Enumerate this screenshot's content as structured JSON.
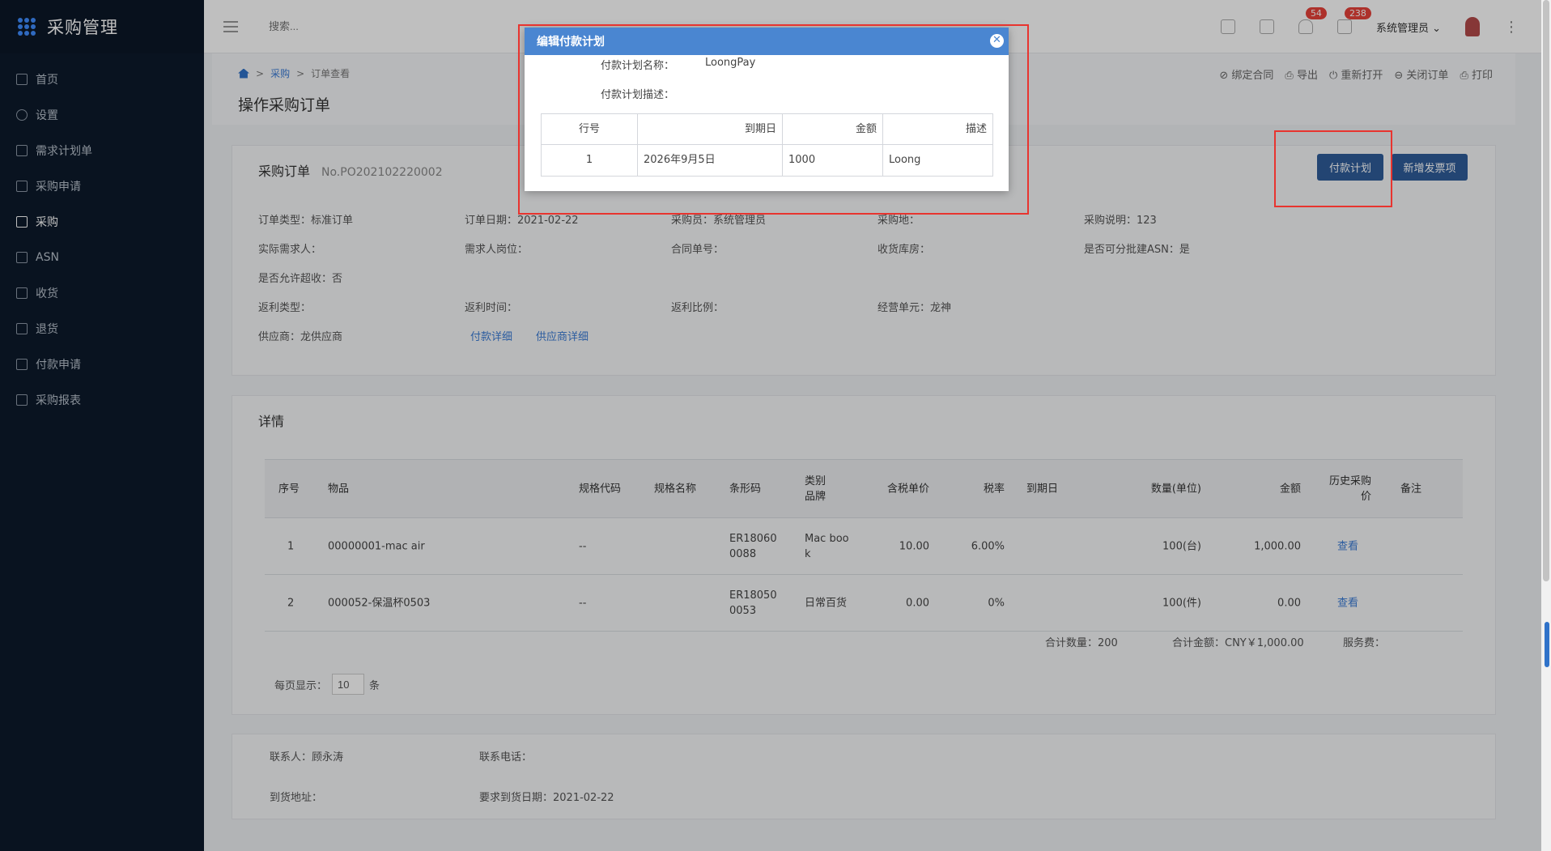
{
  "app": {
    "title": "采购管理"
  },
  "sidebar": {
    "items": [
      {
        "label": "首页",
        "icon": "home-icon"
      },
      {
        "label": "设置",
        "icon": "gear-icon"
      },
      {
        "label": "需求计划单",
        "icon": "document-icon"
      },
      {
        "label": "采购申请",
        "icon": "document-icon"
      },
      {
        "label": "采购",
        "icon": "document-icon",
        "active": true
      },
      {
        "label": "ASN",
        "icon": "truck-icon"
      },
      {
        "label": "收货",
        "icon": "inbox-icon"
      },
      {
        "label": "退货",
        "icon": "exit-icon"
      },
      {
        "label": "付款申请",
        "icon": "document-icon"
      },
      {
        "label": "采购报表",
        "icon": "chart-icon"
      }
    ]
  },
  "topbar": {
    "search_placeholder": "搜索...",
    "notifications_count": "54",
    "messages_count": "238",
    "user_name": "系统管理员"
  },
  "page": {
    "breadcrumb": [
      "采购",
      "订单查看"
    ],
    "title": "操作采购订单",
    "actions": [
      "绑定合同",
      "导出",
      "重新打开",
      "关闭订单",
      "打印"
    ]
  },
  "order": {
    "title": "采购订单",
    "number": "No.PO202102220002",
    "pay_plan_button": "付款计划",
    "new_invoice_button": "新增发票项",
    "fields": {
      "order_type": "订单类型：标准订单",
      "order_date": "订单日期：2021-02-22",
      "buyer": "采购员：系统管理员",
      "purchase_place": "采购地：",
      "purchase_desc": "采购说明：123",
      "actual_requester": "实际需求人：",
      "requester_post": "需求人岗位：",
      "contract_no": "合同单号：",
      "warehouse": "收货库房：",
      "batch_asn": "是否可分批建ASN：是",
      "over_receive": "是否允许超收：否",
      "rebate_type": "返利类型：",
      "rebate_time": "返利时间：",
      "rebate_ratio": "返利比例：",
      "business_unit": "经营单元：龙神",
      "supplier": "供应商：龙供应商"
    },
    "payment_detail_link": "付款详细",
    "supplier_detail_link": "供应商详细"
  },
  "details": {
    "title": "详情",
    "columns": [
      "序号",
      "物品",
      "规格代码",
      "规格名称",
      "条形码",
      "类别",
      "品牌",
      "含税单价",
      "税率",
      "到期日",
      "数量(单位)",
      "金额",
      "历史采购",
      "价",
      "备注"
    ],
    "rows": [
      {
        "no": "1",
        "item": "00000001-mac air",
        "spec_code": "--",
        "barcode_1": "ER18060",
        "barcode_2": "0088",
        "category_1": "Mac boo",
        "category_2": "k",
        "unit_price": "10.00",
        "tax": "6.00%",
        "qty": "100(台)",
        "amount": "1,000.00",
        "view": "查看"
      },
      {
        "no": "2",
        "item": "000052-保温杯0503",
        "spec_code": "--",
        "barcode_1": "ER18050",
        "barcode_2": "0053",
        "category_1": "日常百货",
        "category_2": "",
        "unit_price": "0.00",
        "tax": "0%",
        "qty": "100(件)",
        "amount": "0.00",
        "view": "查看"
      }
    ],
    "total_qty": "合计数量：200",
    "total_amount": "合计金额：CNY￥1,000.00",
    "service_fee": "服务费：",
    "page_size_label": "每页显示：",
    "page_size": "10",
    "page_size_unit": "条"
  },
  "contact": {
    "contact_person": "联系人：顾永涛",
    "contact_phone": "联系电话：",
    "address": "到货地址：",
    "required_date": "要求到货日期：2021-02-22"
  },
  "modal": {
    "title": "编辑付款计划",
    "name_label": "付款计划名称：",
    "name_value": "LoongPay",
    "desc_label": "付款计划描述：",
    "columns": [
      "行号",
      "到期日",
      "金额",
      "描述"
    ],
    "rows": [
      {
        "line": "1",
        "due": "2026年9月5日",
        "amount": "1000",
        "desc": "Loong"
      }
    ]
  }
}
